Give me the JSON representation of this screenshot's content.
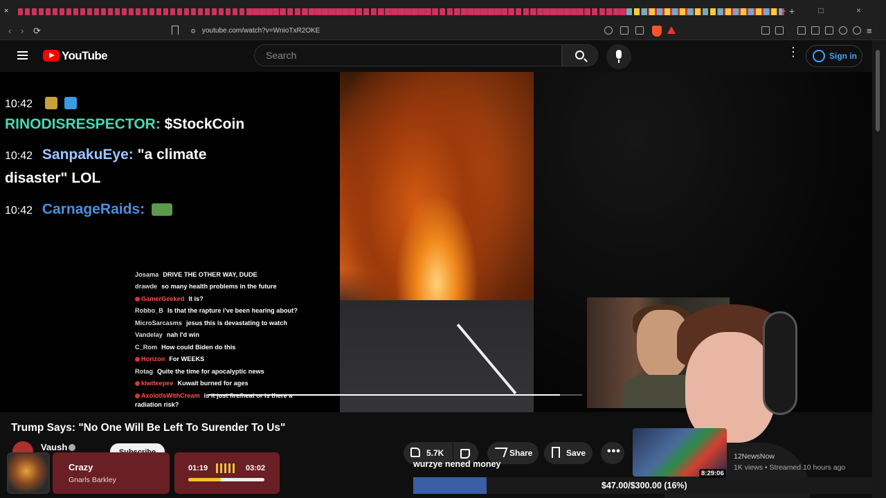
{
  "browser": {
    "url": "youtube.com/watch?v=WnioTxR2OKE",
    "close_tab_glyph": "×",
    "new_tab_glyph": "+",
    "window_controls": "– □ ×",
    "back_glyph": "‹",
    "forward_glyph": "›",
    "reload_glyph": "⟳",
    "site_info_glyph": "⚙"
  },
  "header": {
    "logo_text": "YouTube",
    "search_placeholder": "Search",
    "sign_in_label": "Sign in",
    "more_glyph": "⋮"
  },
  "stream_chat_large": [
    {
      "timestamp": "10:42",
      "user": "",
      "message": "",
      "user_color": "#ffffff"
    },
    {
      "timestamp": "",
      "user": "RINODISRESPECTOR:",
      "message": "$StockCoin",
      "user_color": "#46d9b0"
    },
    {
      "timestamp": "10:42",
      "user": "SanpakuEye:",
      "message": "\"a climate",
      "user_color": "#9bc8ff"
    },
    {
      "timestamp": "",
      "user": "",
      "message": "disaster\" LOL",
      "user_color": "#ffffff"
    },
    {
      "timestamp": "10:42",
      "user": "CarnageRaids:",
      "message": "",
      "user_color": "#4a90e2"
    }
  ],
  "video_overlay_chat": [
    {
      "user": "Josama",
      "message": "DRIVE THE OTHER WAY, DUDE",
      "red": false
    },
    {
      "user": "drawde",
      "message": "so many health problems in the future",
      "red": false
    },
    {
      "user": "GamerGeeked",
      "message": "It is?",
      "red": true
    },
    {
      "user": "Robbo_B",
      "message": "Is that the rapture i've been hearing about?",
      "red": false
    },
    {
      "user": "MicroSarcasms",
      "message": "jesus this is devastating to watch",
      "red": false
    },
    {
      "user": "Vandelay",
      "message": "nah I'd win",
      "red": false
    },
    {
      "user": "C_Rom",
      "message": "How could Biden do this",
      "red": false
    },
    {
      "user": "Horizon",
      "message": "For WEEKS",
      "red": true
    },
    {
      "user": "Rotag",
      "message": "Quite the time for apocalyptic news",
      "red": false
    },
    {
      "user": "kiwiteepee",
      "message": "Kuwait burned for ages",
      "red": true
    },
    {
      "user": "AxolotlsWithCream",
      "message": "is it just fire/heat or is there a",
      "red": true
    },
    {
      "user": "",
      "message": "radiation risk?",
      "red": false
    }
  ],
  "video": {
    "title": "Trump Says: \"No One Will Be Left To Surender To Us\"",
    "channel": "Vaush",
    "subscribe_label": "Subscribe",
    "likes": "5.7K",
    "share_label": "Share",
    "save_label": "Save",
    "more_glyph": "•••",
    "progress_fraction": 0.94
  },
  "overlay_text": "wurzye nened money",
  "now_playing": {
    "title": "Crazy",
    "artist": "Gnarls Barkley",
    "elapsed": "01:19",
    "total": "03:02",
    "progress_fraction": 0.43
  },
  "donation_goal": {
    "text": "$47.00/$300.00 (16%)",
    "fraction": 0.16
  },
  "recommended": {
    "duration": "8:29:06",
    "channel": "12NewsNow",
    "meta": "1K views • Streamed 10 hours ago"
  },
  "colors": {
    "accent_blue": "#3ea6ff",
    "youtube_red": "#ff0000",
    "widget_red": "#6a1f24",
    "goal_blue": "#3b5fa6"
  }
}
